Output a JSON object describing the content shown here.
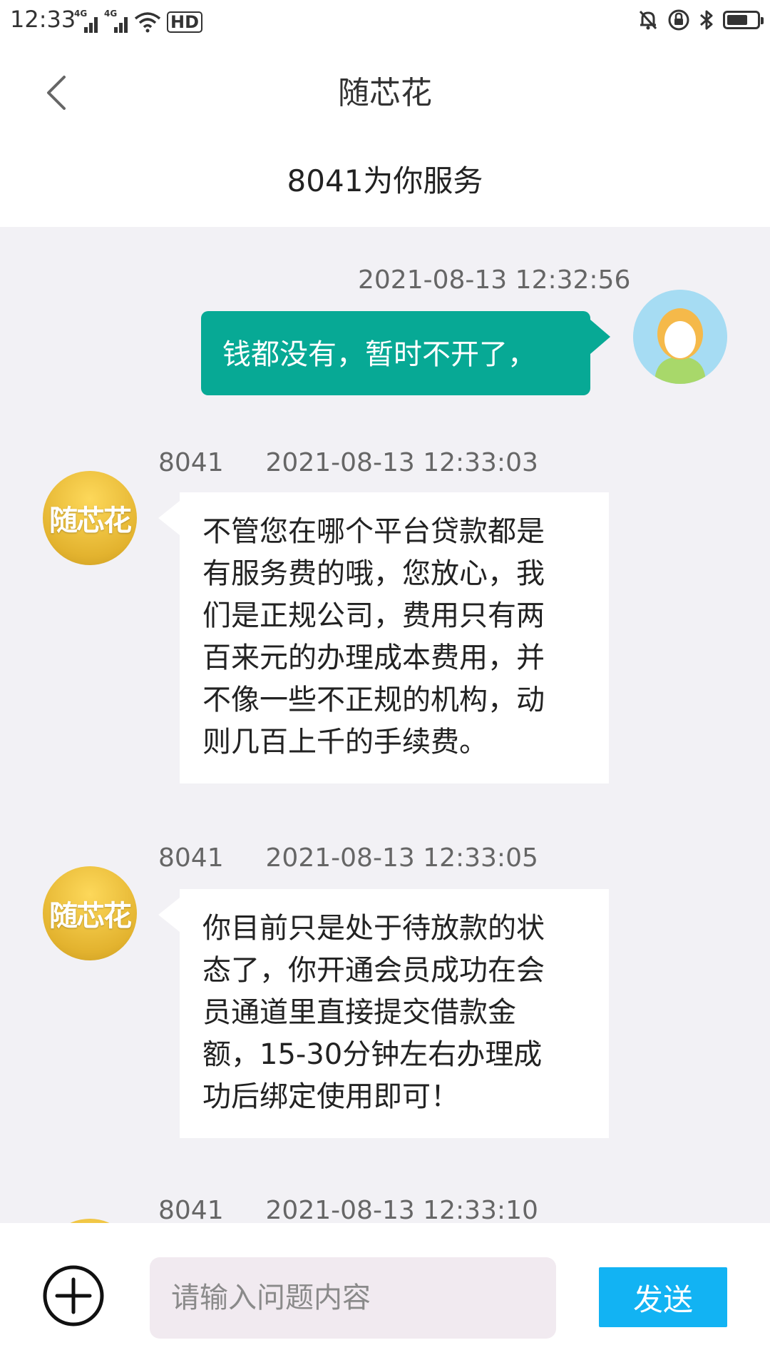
{
  "status_bar": {
    "time": "12:33",
    "sim1_label": "4G",
    "sim2_label": "4G",
    "hd_label": "HD",
    "battery_level": 0.7,
    "icons": [
      "signal-icon",
      "signal-icon",
      "wifi-icon",
      "hd-icon",
      "bell-muted-icon",
      "rotation-lock-icon",
      "bluetooth-icon",
      "battery-icon"
    ]
  },
  "header": {
    "title": "随芯花",
    "subtitle": "8041为你服务"
  },
  "messages": [
    {
      "from": "me",
      "timestamp": "2021-08-13 12:32:56",
      "text": "钱都没有，暂时不开了，"
    },
    {
      "from": "agent",
      "agent_id": "8041",
      "timestamp": "2021-08-13 12:33:03",
      "avatar_text": "随芯花",
      "lines": [
        "不管您在哪个平台贷款都是",
        "有服务费的哦，您放心，我",
        "们是正规公司，费用只有两",
        "百来元的办理成本费用，并",
        "不像一些不正规的机构，动",
        "则几百上千的手续费。"
      ]
    },
    {
      "from": "agent",
      "agent_id": "8041",
      "timestamp": "2021-08-13 12:33:05",
      "avatar_text": "随芯花",
      "lines": [
        "你目前只是处于待放款的状",
        "态了，你开通会员成功在会",
        "员通道里直接提交借款金",
        "额，15-30分钟左右办理成",
        "功后绑定使用即可！"
      ]
    },
    {
      "from": "agent",
      "agent_id": "8041",
      "timestamp": "2021-08-13 12:33:10"
    }
  ],
  "input_bar": {
    "placeholder": "请输入问题内容",
    "value": "",
    "send_label": "发送"
  },
  "colors": {
    "my_bubble": "#07a995",
    "send_button": "#12b3f3",
    "chat_background": "#f2f1f5"
  }
}
